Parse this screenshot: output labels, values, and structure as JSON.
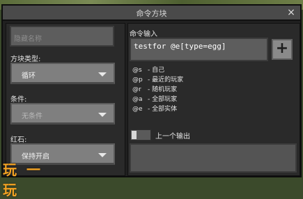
{
  "window": {
    "title": "命令方块",
    "close_label": "×"
  },
  "left": {
    "name_placeholder": "隐藏名称",
    "block_type_label": "方块类型:",
    "block_type_value": "循环",
    "condition_label": "条件:",
    "condition_value": "无条件",
    "redstone_label": "红石:",
    "redstone_value": "保持开启"
  },
  "right": {
    "command_label": "命令输入",
    "command_value": "testfor @e[type=egg]",
    "plus_label": "+",
    "help": [
      {
        "key": "@s",
        "desc": "- 自己"
      },
      {
        "key": "@p",
        "desc": "- 最近的玩家"
      },
      {
        "key": "@r",
        "desc": "- 随机玩家"
      },
      {
        "key": "@a",
        "desc": "- 全部玩家"
      },
      {
        "key": "@e",
        "desc": "- 全部实体"
      }
    ],
    "previous_output_label": "上一个输出"
  },
  "watermark": "玩一玩"
}
